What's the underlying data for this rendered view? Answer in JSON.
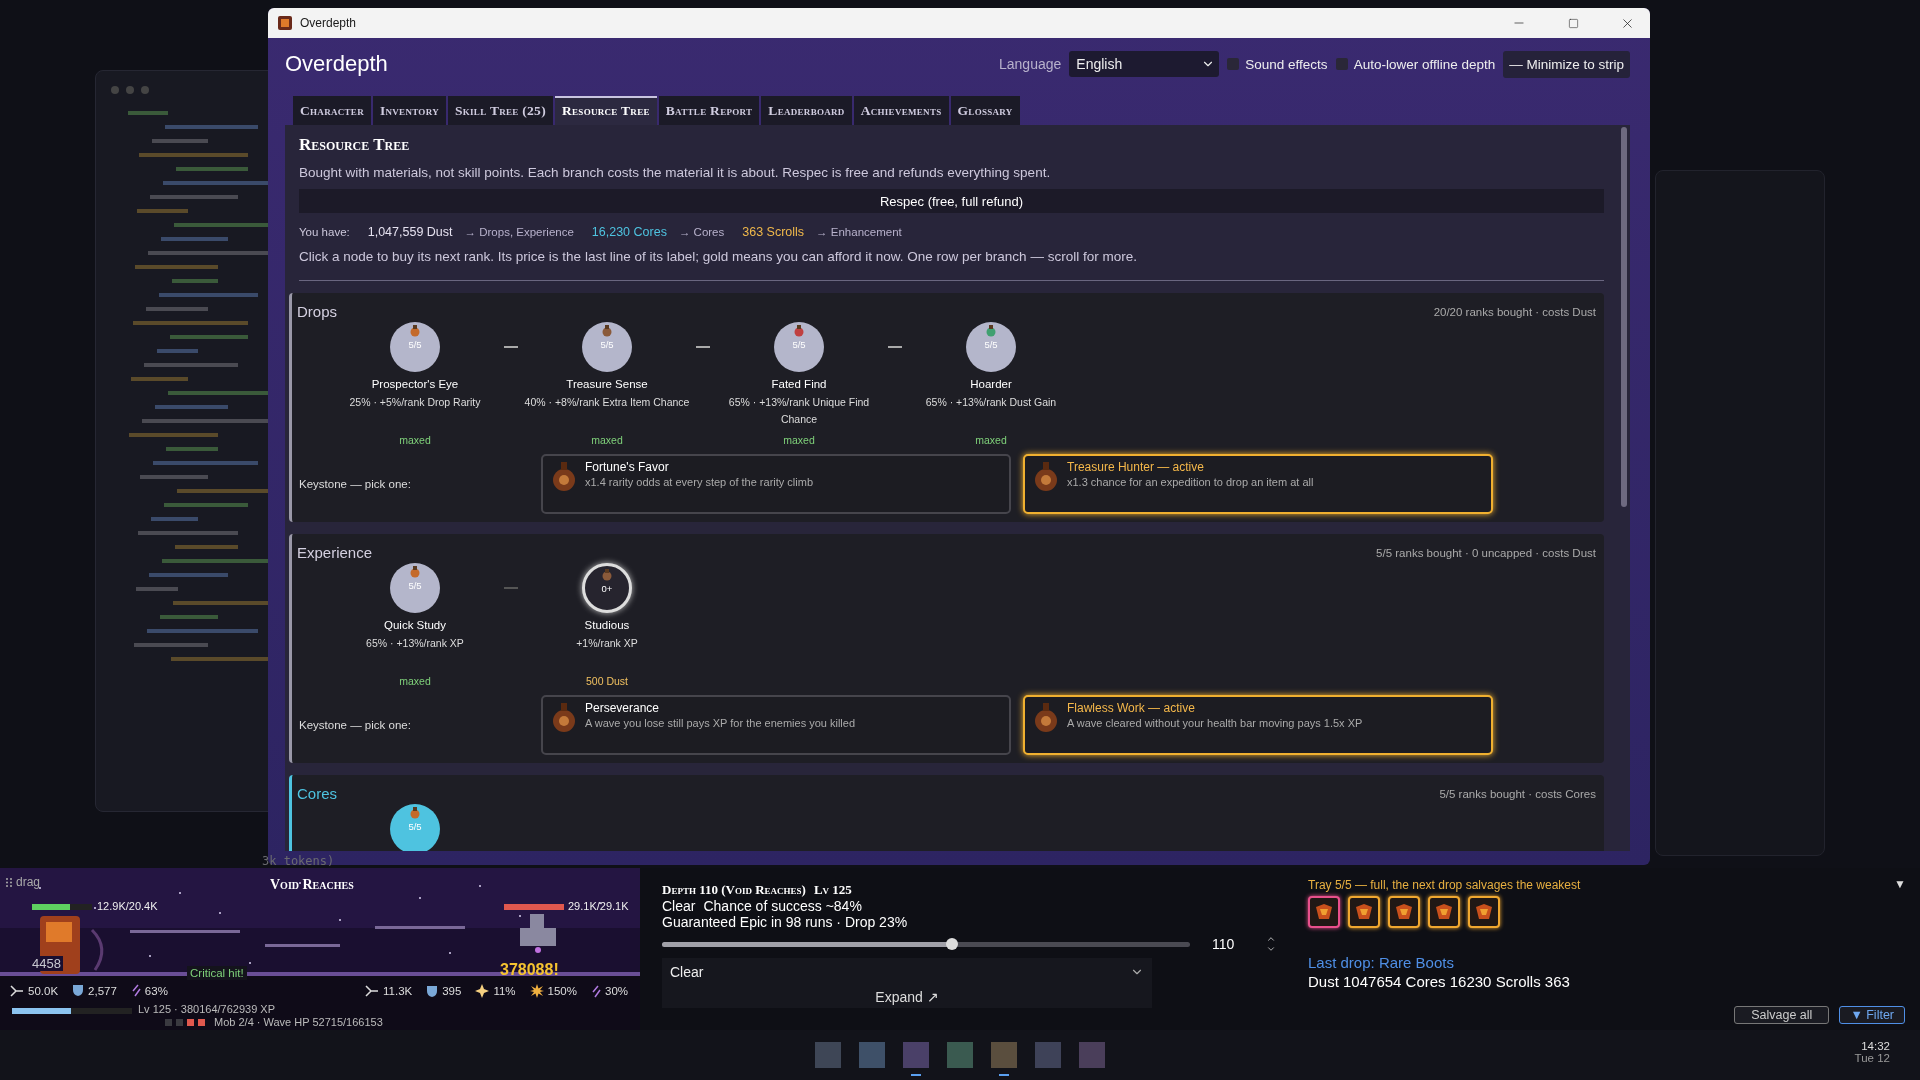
{
  "background": {
    "text": "3k tokens)"
  },
  "window": {
    "title": "Overdepth"
  },
  "header": {
    "title": "Overdepth",
    "language_label": "Language",
    "language": "English",
    "options": [
      {
        "label": "Sound effects",
        "checked": false
      },
      {
        "label": "Auto-lower offline depth",
        "checked": false
      }
    ],
    "minimize_button": "— Minimize to strip"
  },
  "tabs": [
    {
      "label": "Character",
      "selected": false
    },
    {
      "label": "Inventory",
      "selected": false
    },
    {
      "label": "Skill Tree (25)",
      "selected": false
    },
    {
      "label": "Resource Tree",
      "selected": true
    },
    {
      "label": "Battle Report",
      "selected": false
    },
    {
      "label": "Leaderboard",
      "selected": false
    },
    {
      "label": "Achievements",
      "selected": false
    },
    {
      "label": "Glossary",
      "selected": false
    }
  ],
  "page": {
    "title": "Resource Tree",
    "intro": "Bought with materials, not skill points. Each branch costs the material it is about. Respec is free and refunds everything spent.",
    "respec_button": "Respec (free, full refund)",
    "you_have_label": "You have:",
    "materials": [
      {
        "amount": "1,047,559 Dust",
        "color": "#e6e2f0",
        "used_for": "→ Drops, Experience"
      },
      {
        "amount": "16,230 Cores",
        "color": "#4ec3e0",
        "used_for": "→ Cores"
      },
      {
        "amount": "363 Scrolls",
        "color": "#f0b84a",
        "used_for": "→ Enhancement"
      }
    ],
    "hint": "Click a node to buy its next rank. Its price is the last line of its label; gold means you can afford it now. One row per branch — scroll for more."
  },
  "branches": [
    {
      "name": "Drops",
      "color": "#9a98a8",
      "summary": "20/20 ranks bought · costs Dust",
      "keystone_label": "Keystone — pick one:",
      "nodes": [
        {
          "kind": "maxed",
          "rank": "5/5",
          "name": "Prospector's Eye",
          "effect": "25% · +5%/rank Drop Rarity",
          "status": "maxed"
        },
        {
          "kind": "maxed",
          "rank": "5/5",
          "name": "Treasure Sense",
          "effect": "40% · +8%/rank Extra Item Chance",
          "status": "maxed"
        },
        {
          "kind": "maxed",
          "rank": "5/5",
          "name": "Fated Find",
          "effect": "65% · +13%/rank Unique Find Chance",
          "status": "maxed"
        },
        {
          "kind": "maxed",
          "rank": "5/5",
          "name": "Hoarder",
          "effect": "65% · +13%/rank Dust Gain",
          "status": "maxed"
        }
      ],
      "keystones": [
        {
          "name": "Fortune's Favor",
          "description": "x1.4 rarity odds at every step of the rarity climb",
          "selected": false
        },
        {
          "name": "Treasure Hunter — active",
          "description": "x1.3 chance for an expedition to drop an item at all",
          "selected": true
        }
      ]
    },
    {
      "name": "Experience",
      "color": "#9a98a8",
      "summary": "5/5 ranks bought · 0 uncapped · costs Dust",
      "keystone_label": "Keystone — pick one:",
      "nodes": [
        {
          "kind": "maxed",
          "rank": "5/5",
          "name": "Quick Study",
          "effect": "65% · +13%/rank XP",
          "status": "maxed"
        },
        {
          "kind": "buyable",
          "rank": "0+",
          "name": "Studious",
          "effect": "+1%/rank XP",
          "status": "500 Dust"
        }
      ],
      "keystones": [
        {
          "name": "Perseverance",
          "description": "A wave you lose still pays XP for the enemies you killed",
          "selected": false
        },
        {
          "name": "Flawless Work — active",
          "description": "A wave cleared without your health bar moving pays 1.5x XP",
          "selected": true
        }
      ]
    },
    {
      "name": "Cores",
      "color": "#4ec3e0",
      "summary": "5/5 ranks bought · costs Cores",
      "nodes": [
        {
          "kind": "maxed",
          "rank": "5/5"
        }
      ]
    }
  ],
  "game": {
    "drag": "drag",
    "zone": "Void Reaches",
    "hero_hp": {
      "text": "12.9K/20.4K",
      "level": 0.63
    },
    "enemy_hp": {
      "text": "29.1K/29.1K",
      "level": 1
    },
    "hero_hit": "4458",
    "crit": "Critical hit!",
    "enemy_hit": "378088!",
    "hero_stats": [
      {
        "kind": "attack",
        "value": "50.0K"
      },
      {
        "kind": "armor",
        "value": "2,577"
      },
      {
        "kind": "speed",
        "value": "63%"
      }
    ],
    "enemy_stats": [
      {
        "kind": "attack",
        "value": "11.3K"
      },
      {
        "kind": "armor",
        "value": "395"
      },
      {
        "kind": "crit",
        "value": "11%"
      },
      {
        "kind": "crit_damage",
        "value": "150%"
      },
      {
        "kind": "speed",
        "value": "30%"
      }
    ],
    "xp": {
      "level": 0.49,
      "text": "Lv 125 · 380164/762939 XP"
    },
    "mobs": [
      {
        "cleared": false
      },
      {
        "cleared": false
      },
      {
        "cleared": true
      },
      {
        "cleared": true
      }
    ],
    "wave_text": "Mob 2/4 · Wave HP 52715/166153"
  },
  "expedition": {
    "title": "Depth 110 (Void Reaches)",
    "level_text": "Lv 125",
    "mode": "Clear",
    "chance": "Chance of success ~84%",
    "guarantee": "Guaranteed Epic in 98 runs · Drop 23%",
    "depth": {
      "level": 0.55,
      "value": "110"
    },
    "select": "Clear",
    "expand_button": "Expand ↗"
  },
  "tray": {
    "label": "Tray 5/5 — full, the next drop salvages the weakest",
    "items": [
      {
        "color": "#e8508c"
      },
      {
        "color": "#f0a830"
      },
      {
        "color": "#f0a830"
      },
      {
        "color": "#f0a830"
      },
      {
        "color": "#f0a830"
      }
    ],
    "last_drop": "Last drop: Rare Boots",
    "totals": "Dust 1047654  Cores 16230  Scrolls 363",
    "salvage_button": "Salvage all",
    "filter_button": "▼ Filter",
    "collapse": "▼"
  },
  "taskbar": {
    "apps": [
      {
        "color": "#3e4656",
        "active": false
      },
      {
        "color": "#3e5068",
        "active": false
      },
      {
        "color": "#4a4068",
        "active": true
      },
      {
        "color": "#3a5a50",
        "active": false
      },
      {
        "color": "#5a4e3e",
        "active": true
      },
      {
        "color": "#3e4258",
        "active": false
      },
      {
        "color": "#4a3e5a",
        "active": false
      }
    ],
    "time": "14:32",
    "date": "Tue 12"
  }
}
